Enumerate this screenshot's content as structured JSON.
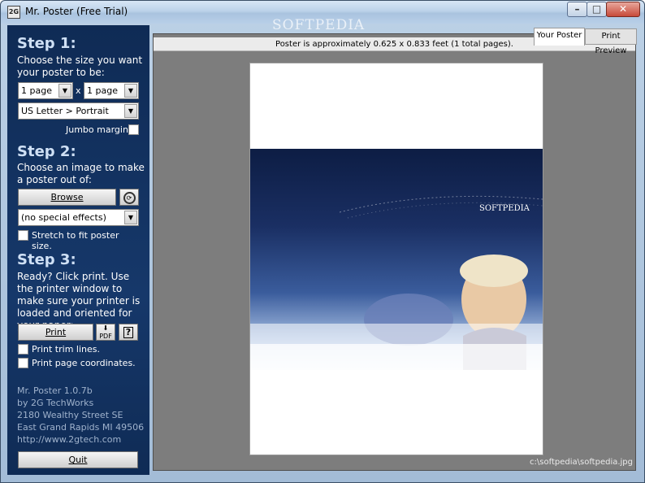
{
  "window": {
    "title": "Mr. Poster (Free Trial)",
    "watermark": "SOFTPEDIA",
    "controls": {
      "minimize": "–",
      "maximize": "□",
      "close": "✕"
    }
  },
  "sidebar": {
    "step1": {
      "title": "Step 1:",
      "text": "Choose the size you want your poster to be:",
      "width_value": "1 page",
      "times": "x",
      "height_value": "1 page",
      "paper_value": "US Letter > Portrait",
      "jumbo_label": "Jumbo margins"
    },
    "step2": {
      "title": "Step 2:",
      "text": "Choose an image to make a poster out of:",
      "browse_label": "Browse",
      "effects_value": "(no special effects)",
      "stretch_label": "Stretch to fit poster size."
    },
    "step3": {
      "title": "Step 3:",
      "text": "Ready?  Click print. Use the printer window to make sure your printer is loaded and oriented for your paper:",
      "print_label": "Print",
      "pdf_label": "PDF",
      "help_label": "?",
      "trim_label": "Print trim lines.",
      "coords_label": "Print page coordinates."
    },
    "about": {
      "line1": "Mr. Poster 1.0.7b",
      "line2": "by 2G TechWorks",
      "line3": "2180 Wealthy Street SE",
      "line4": "East Grand Rapids  MI  49506",
      "line5": "http://www.2gtech.com"
    },
    "quit_label": "Quit"
  },
  "main": {
    "info": "Poster is approximately 0.625 x 0.833 feet (1 total pages).",
    "tabs": [
      "Your Poster",
      "Print Preview"
    ],
    "poster_text": "SOFTPEDIA",
    "file_path": "c:\\softpedia\\softpedia.jpg"
  },
  "colors": {
    "sidebar_bg": "#16386a",
    "step_title": "#cfe0f5",
    "canvas_bg": "#7d7d7d"
  }
}
